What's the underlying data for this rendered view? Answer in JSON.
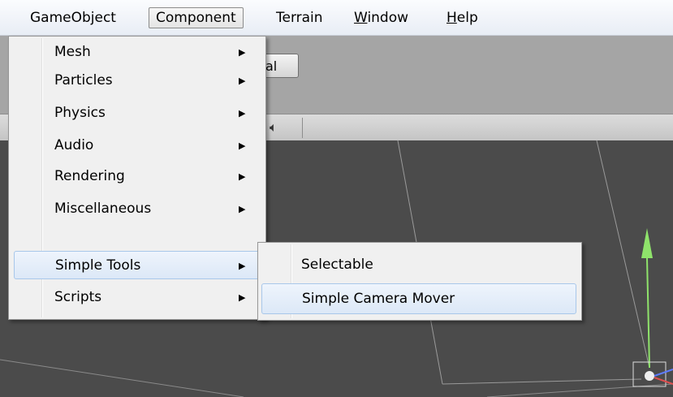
{
  "menubar": {
    "items": [
      {
        "label": "GameObject"
      },
      {
        "label": "Component"
      },
      {
        "label": "Terrain"
      },
      {
        "pre": "",
        "accel": "W",
        "post": "indow"
      },
      {
        "pre": "",
        "accel": "H",
        "post": "elp"
      }
    ]
  },
  "background": {
    "toolbar_button_fragment": "al",
    "speaker_icon": "speaker-icon"
  },
  "component_menu": {
    "items": [
      {
        "label": "Mesh",
        "submenu": true
      },
      {
        "label": "Particles",
        "submenu": true
      },
      {
        "label": "Physics",
        "submenu": true
      },
      {
        "label": "Audio",
        "submenu": true
      },
      {
        "label": "Rendering",
        "submenu": true
      },
      {
        "label": "Miscellaneous",
        "submenu": true
      },
      {
        "label": "Simple Tools",
        "submenu": true,
        "highlighted": true
      },
      {
        "label": "Scripts",
        "submenu": true
      }
    ]
  },
  "simple_tools_menu": {
    "items": [
      {
        "label": "Selectable"
      },
      {
        "label": "Simple Camera Mover",
        "highlighted": true
      }
    ]
  },
  "colors": {
    "highlight_border": "#a8c7ea",
    "gizmo_green": "#8fe36b",
    "viewport_bg": "#4b4b4b"
  }
}
